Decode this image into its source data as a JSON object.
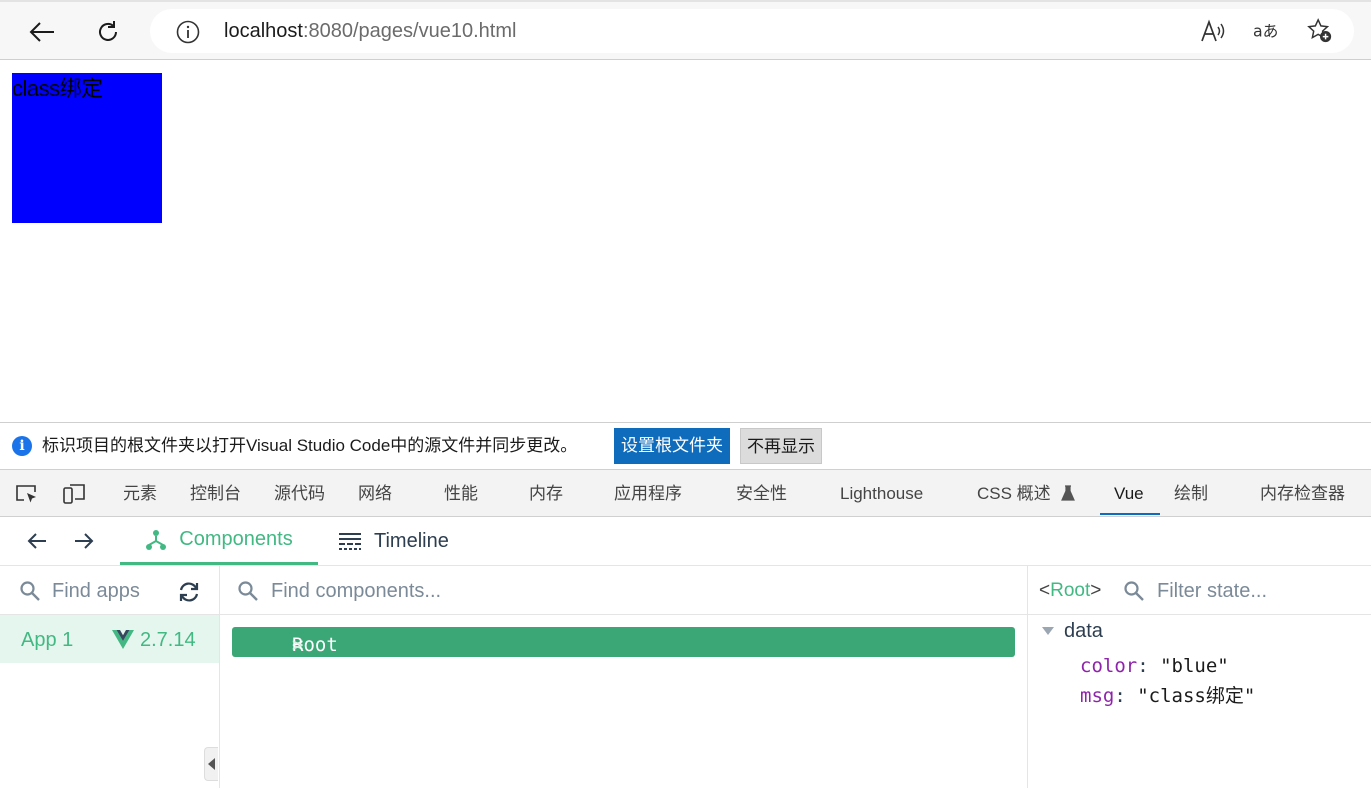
{
  "browser": {
    "url_host": "localhost",
    "url_rest": ":8080/pages/vue10.html",
    "icons": [
      "back-arrow-icon",
      "refresh-icon",
      "info-icon",
      "read-aloud-icon",
      "translate-icon",
      "favorite-add-icon"
    ]
  },
  "page": {
    "box_text": "class绑定",
    "box_color": "#0000ff"
  },
  "infobar": {
    "message": "标识项目的根文件夹以打开Visual Studio Code中的源文件并同步更改。",
    "primary_button": "设置根文件夹",
    "secondary_button": "不再显示"
  },
  "devtools": {
    "tabs": [
      "元素",
      "控制台",
      "源代码",
      "网络",
      "性能",
      "内存",
      "应用程序",
      "安全性",
      "Lighthouse",
      "CSS 概述",
      "Vue",
      "绘制",
      "内存检查器"
    ],
    "active_tab": "Vue",
    "accent": "#0f6cbd"
  },
  "vue": {
    "tabs": {
      "components": "Components",
      "timeline": "Timeline"
    },
    "apps_search_placeholder": "Find apps",
    "components_search_placeholder": "Find components...",
    "state_search_placeholder": "Filter state...",
    "app": {
      "name": "App 1",
      "version": "2.7.14"
    },
    "tree_root": {
      "open": "<",
      "name": "Root",
      "close": ">"
    },
    "selected": {
      "open": "<",
      "name": "Root",
      "close": ">"
    },
    "state_section": "data",
    "state": [
      {
        "key": "color",
        "value": "\"blue\""
      },
      {
        "key": "msg",
        "value": "\"class绑定\""
      }
    ],
    "accent": "#42b883"
  }
}
